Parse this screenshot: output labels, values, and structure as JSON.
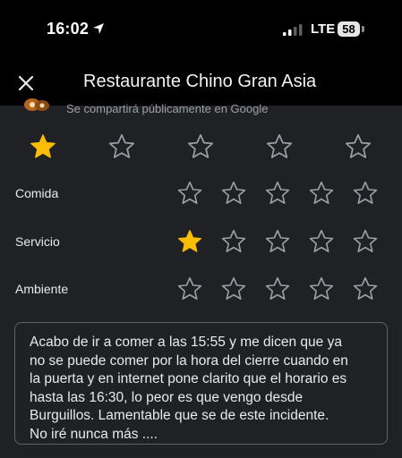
{
  "status_bar": {
    "time": "16:02",
    "network": "LTE",
    "battery": "58"
  },
  "header": {
    "title": "Restaurante Chino Gran Asia"
  },
  "notice": {
    "text": "Se compartirá públicamente en Google"
  },
  "overall_rating": {
    "value": 1,
    "max": 5
  },
  "categories": [
    {
      "label": "Comida",
      "value": 0
    },
    {
      "label": "Servicio",
      "value": 1
    },
    {
      "label": "Ambiente",
      "value": 0
    }
  ],
  "review": {
    "text": "Acabo de ir a comer a las 15:55 y me dicen que ya\nno se puede comer por la hora del cierre cuando en\nla puerta y en internet pone clarito que el horario es\nhasta las 16:30, lo peor es que vengo desde\nBurguillos. Lamentable que se de este incidente.\nNo iré nunca más ...."
  },
  "colors": {
    "star_filled": "#fbbc04",
    "star_empty": "#9aa0a6",
    "background": "#202124"
  },
  "icons": {
    "close": "close-icon",
    "location": "location-arrow-icon",
    "signal": "signal-icon",
    "star": "star-icon"
  }
}
